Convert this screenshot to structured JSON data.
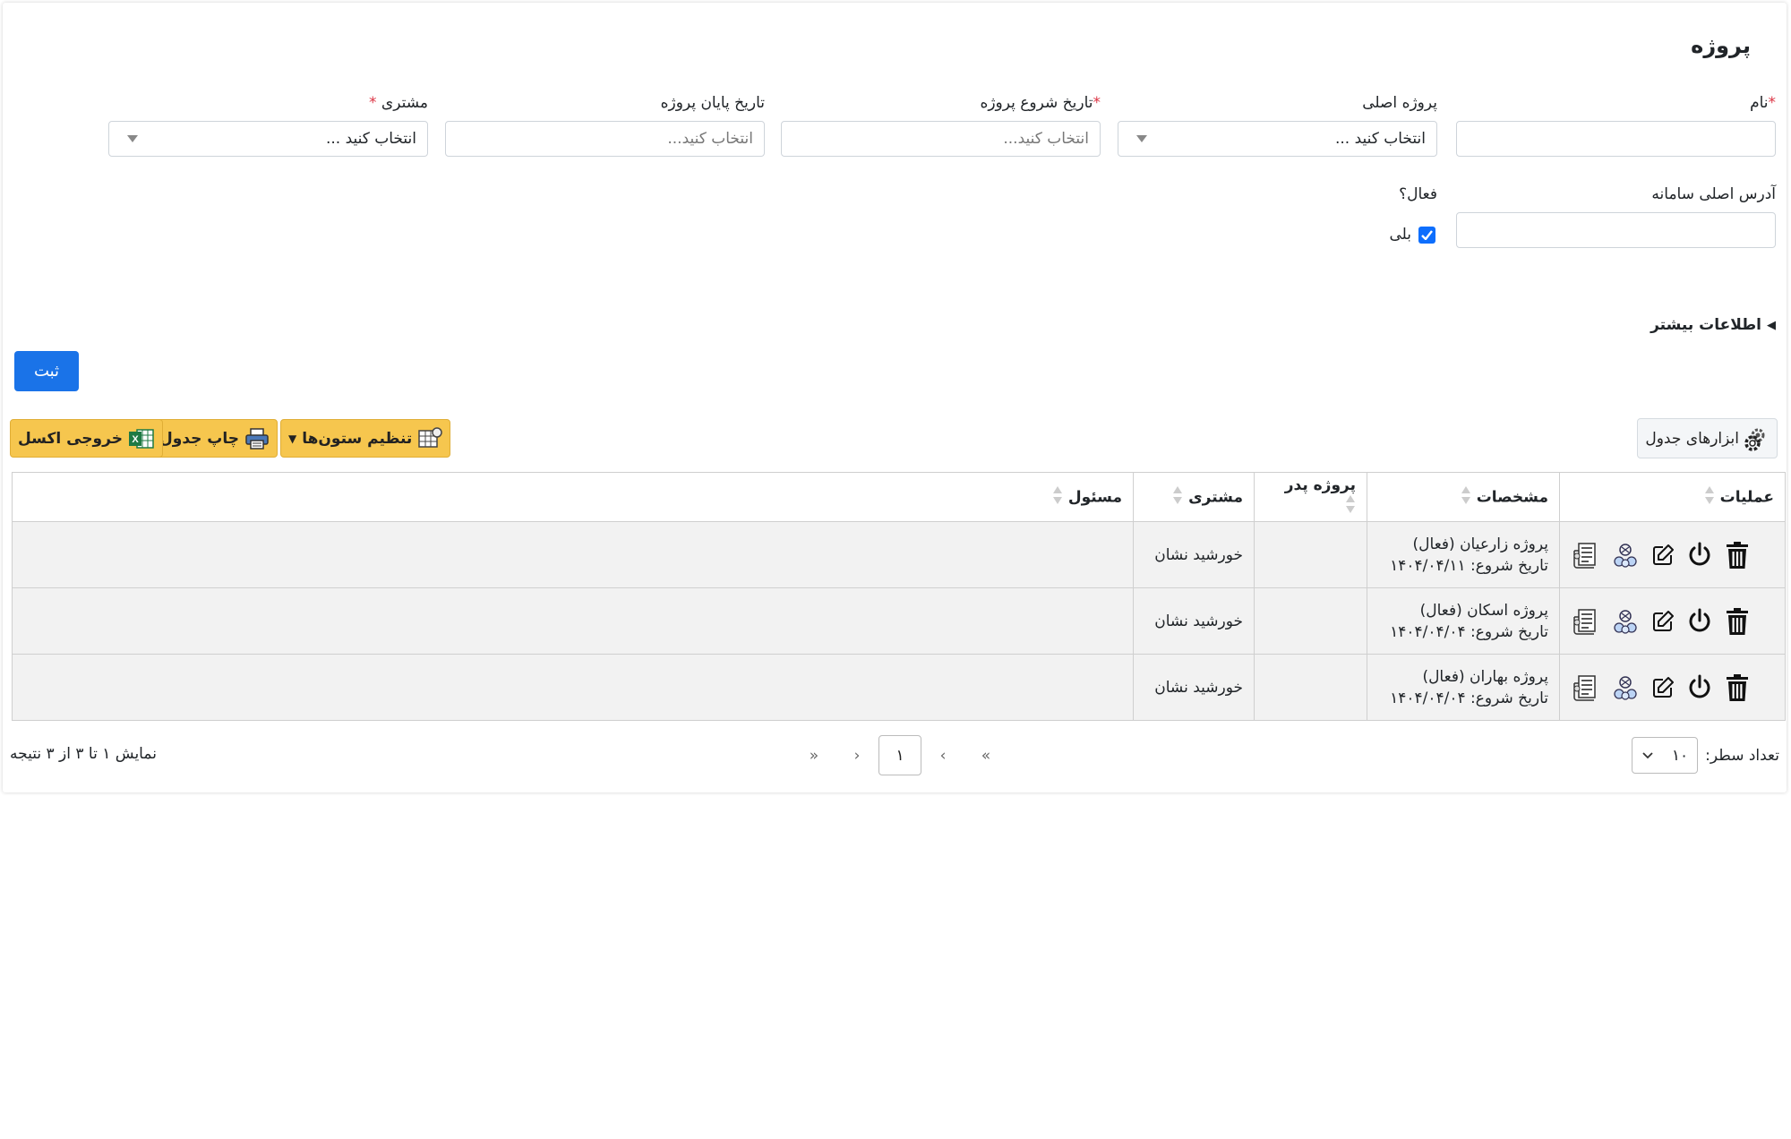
{
  "page": {
    "title": "پروژه"
  },
  "form": {
    "name": {
      "label": "نام",
      "value": ""
    },
    "main_project": {
      "label": "پروژه اصلی",
      "value": "انتخاب کنید ..."
    },
    "start_date": {
      "label": "تاریخ شروع پروژه",
      "placeholder": "انتخاب کنید..."
    },
    "end_date": {
      "label": "تاریخ پایان پروژه",
      "placeholder": "انتخاب کنید..."
    },
    "customer": {
      "label": "مشتری",
      "value": "انتخاب کنید ..."
    },
    "system_address": {
      "label": "آدرس اصلی سامانه",
      "value": ""
    },
    "active": {
      "label": "فعال؟",
      "option_label": "بلی",
      "checked": true
    },
    "required_mark": "*",
    "more_info": "اطلاعات بیشتر",
    "submit_label": "ثبت"
  },
  "toolbar": {
    "table_tools": "ابزارهای جدول",
    "column_settings": "تنظیم ستون‌ها",
    "print_table": "چاپ جدول",
    "excel_export": "خروجی اکسل"
  },
  "table": {
    "headers": {
      "operations": "عملیات",
      "specs": "مشخصات",
      "parent_project": "پروژه پدر",
      "customer": "مشتری",
      "responsible": "مسئول"
    },
    "rows": [
      {
        "title": "پروژه زارعیان (فعال)",
        "start": "تاریخ شروع: ۱۴۰۴/۰۴/۱۱",
        "parent": "",
        "customer": "خورشید نشان",
        "responsible": ""
      },
      {
        "title": "پروژه اسکان (فعال)",
        "start": "تاریخ شروع: ۱۴۰۴/۰۴/۰۴",
        "parent": "",
        "customer": "خورشید نشان",
        "responsible": ""
      },
      {
        "title": "پروژه بهاران (فعال)",
        "start": "تاریخ شروع: ۱۴۰۴/۰۴/۰۴",
        "parent": "",
        "customer": "خورشید نشان",
        "responsible": ""
      }
    ]
  },
  "footer": {
    "rows_label": "تعداد سطر:",
    "rows_value": "۱۰",
    "pagination": {
      "first": "«",
      "prev": "‹",
      "current": "۱",
      "next": "›",
      "last": "»"
    },
    "summary": "نمایش ۱ تا ۳ از ۳ نتیجه"
  },
  "colors": {
    "primary": "#1a73e8",
    "tool_button": "#f6c64e",
    "required": "#dc3545",
    "row_bg": "#f2f2f2"
  }
}
